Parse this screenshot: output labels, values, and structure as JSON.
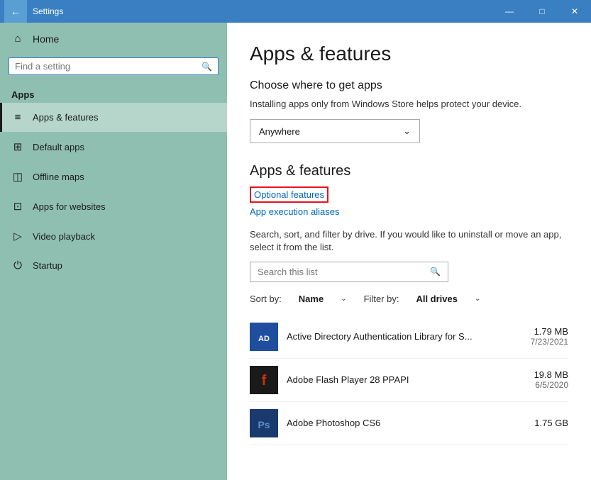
{
  "titlebar": {
    "back_icon": "←",
    "title": "Settings",
    "minimize_icon": "—",
    "maximize_icon": "□",
    "close_icon": "✕"
  },
  "sidebar": {
    "home_label": "Home",
    "search_placeholder": "Find a setting",
    "section_label": "Apps",
    "items": [
      {
        "id": "apps-features",
        "label": "Apps & features",
        "icon": "≡•",
        "active": true
      },
      {
        "id": "default-apps",
        "label": "Default apps",
        "icon": "⊞",
        "active": false
      },
      {
        "id": "offline-maps",
        "label": "Offline maps",
        "icon": "◫",
        "active": false
      },
      {
        "id": "apps-websites",
        "label": "Apps for websites",
        "icon": "⊡",
        "active": false
      },
      {
        "id": "video-playback",
        "label": "Video playback",
        "icon": "▷",
        "active": false
      },
      {
        "id": "startup",
        "label": "Startup",
        "icon": "⊿",
        "active": false
      }
    ]
  },
  "content": {
    "page_title": "Apps & features",
    "choose_heading": "Choose where to get apps",
    "choose_description": "Installing apps only from Windows Store helps protect your device.",
    "dropdown_value": "Anywhere",
    "dropdown_icon": "⌄",
    "apps_features_title": "Apps & features",
    "optional_features_label": "Optional features",
    "app_execution_label": "App execution aliases",
    "search_description": "Search, sort, and filter by drive. If you would like to uninstall or move an app, select it from the list.",
    "search_placeholder": "Search this list",
    "sort_label": "Sort by:",
    "sort_value": "Name",
    "sort_icon": "⌄",
    "filter_label": "Filter by:",
    "filter_value": "All drives",
    "filter_icon": "⌄",
    "apps": [
      {
        "name": "Active Directory Authentication Library for S...",
        "size": "1.79 MB",
        "date": "7/23/2021",
        "icon_color": "#1e4e9d",
        "icon_letter": "AD"
      },
      {
        "name": "Adobe Flash Player 28 PPAPI",
        "size": "19.8 MB",
        "date": "6/5/2020",
        "icon_color": "#cc2200",
        "icon_letter": "F"
      },
      {
        "name": "Adobe Photoshop CS6",
        "size": "1.75 GB",
        "date": "",
        "icon_color": "#1a3a6e",
        "icon_letter": "Ps"
      }
    ]
  }
}
